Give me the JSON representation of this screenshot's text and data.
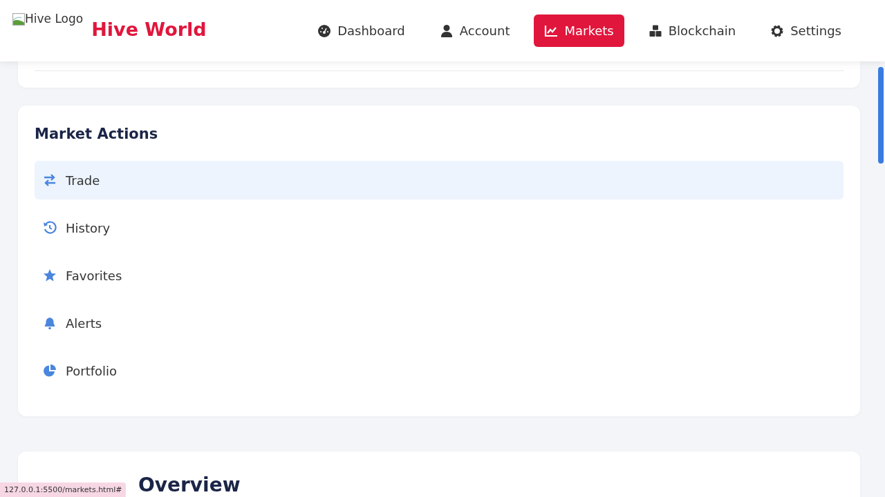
{
  "header": {
    "logo_alt": "Hive Logo",
    "brand": "Hive World",
    "nav": [
      {
        "label": "Dashboard",
        "kind": "gauge",
        "selected": false
      },
      {
        "label": "Account",
        "kind": "user",
        "selected": false
      },
      {
        "label": "Markets",
        "kind": "chart",
        "selected": true
      },
      {
        "label": "Blockchain",
        "kind": "cubes",
        "selected": false
      },
      {
        "label": "Settings",
        "kind": "gear",
        "selected": false
      }
    ]
  },
  "market_actions": {
    "title": "Market Actions",
    "items": [
      {
        "label": "Trade",
        "kind": "exchange",
        "selected": true
      },
      {
        "label": "History",
        "kind": "history",
        "selected": false
      },
      {
        "label": "Favorites",
        "kind": "star",
        "selected": false
      },
      {
        "label": "Alerts",
        "kind": "bell",
        "selected": false
      },
      {
        "label": "Portfolio",
        "kind": "pie",
        "selected": false
      }
    ]
  },
  "market_overview": {
    "title": "Overview"
  },
  "status_url": "127.0.0.1:5500/markets.html#"
}
